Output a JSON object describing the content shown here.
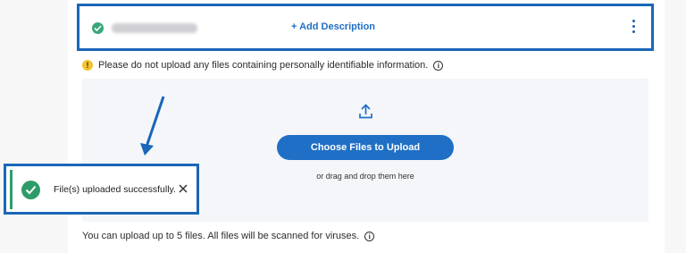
{
  "file_row": {
    "add_description": "+ Add Description",
    "status_icon": "check-circle-icon",
    "menu_icon": "kebab-menu-icon"
  },
  "warning": {
    "icon": "warning-icon",
    "text": "Please do not upload any files containing personally identifiable information.",
    "info_icon": "info-icon"
  },
  "dropzone": {
    "icon": "upload-icon",
    "button_label": "Choose Files to Upload",
    "drag_text": "or drag and drop them here"
  },
  "footer": {
    "text": "You can upload up to 5 files. All files will be scanned for viruses.",
    "info_icon": "info-icon"
  },
  "toast": {
    "icon": "check-circle-icon",
    "message": "File(s) uploaded successfully.",
    "close_icon": "close-icon"
  },
  "colors": {
    "accent": "#1f6fc6",
    "highlight_border": "#1a66b8",
    "success": "#2e9c6a",
    "warning": "#f2c230"
  }
}
